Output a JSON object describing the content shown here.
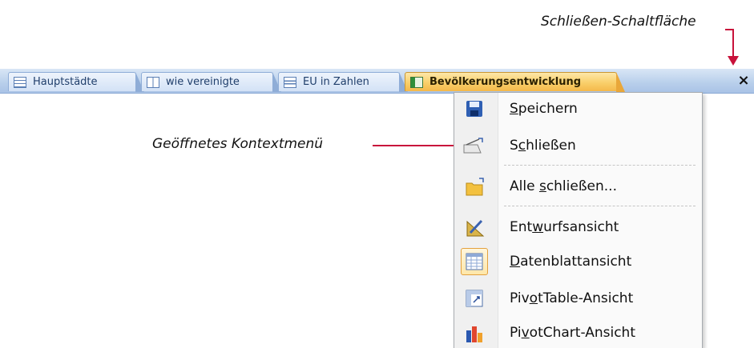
{
  "annotations": {
    "close_button": "Schließen-Schaltfläche",
    "context_menu": "Geöffnetes Kontextmenü",
    "arrow_color": "#c8123b"
  },
  "tabs": [
    {
      "label": "Hauptstädte",
      "icon": "table-icon",
      "active": false
    },
    {
      "label": "wie vereinigte",
      "icon": "query-icon",
      "active": false
    },
    {
      "label": "EU in Zahlen",
      "icon": "form-icon",
      "active": false
    },
    {
      "label": "Bevölkerungsentwicklung",
      "icon": "report-icon",
      "active": true
    }
  ],
  "close_glyph": "×",
  "menu": {
    "items": [
      {
        "pre": "",
        "u": "S",
        "post": "peichern",
        "icon": "save-icon"
      },
      {
        "pre": "S",
        "u": "c",
        "post": "hließen",
        "icon": "close-folder-icon"
      },
      {
        "pre": "Alle ",
        "u": "s",
        "post": "chließen...",
        "icon": "close-all-icon"
      },
      {
        "pre": "Ent",
        "u": "w",
        "post": "urfsansicht",
        "icon": "design-view-icon"
      },
      {
        "pre": "",
        "u": "D",
        "post": "atenblattansicht",
        "icon": "datasheet-view-icon"
      },
      {
        "pre": "Piv",
        "u": "o",
        "post": "tTable-Ansicht",
        "icon": "pivottable-icon"
      },
      {
        "pre": "Pi",
        "u": "v",
        "post": "otChart-Ansicht",
        "icon": "pivotchart-icon"
      }
    ]
  }
}
